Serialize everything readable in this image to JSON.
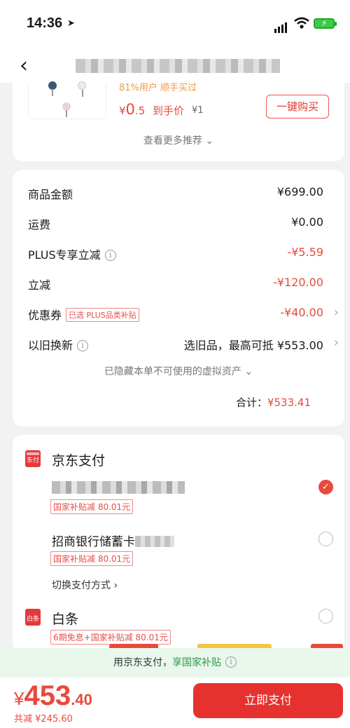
{
  "status": {
    "time": "14:36",
    "battery_symbol": "⚡"
  },
  "nav": {
    "back_glyph": "‹"
  },
  "recommend": {
    "sale_line": "81%用户 顺手买过",
    "currency": "¥",
    "price_int": "0",
    "price_dec": ".5",
    "price_suffix": "到手价",
    "orig_price": "¥1",
    "buy_button": "一键购买",
    "more_text": "查看更多推荐 ⌄"
  },
  "summary": {
    "rows": [
      {
        "label": "商品金额",
        "value": "¥699.00"
      },
      {
        "label": "运费",
        "value": "¥0.00"
      },
      {
        "label": "PLUS专享立减",
        "value": "-¥5.59"
      },
      {
        "label": "立减",
        "value": "-¥120.00"
      },
      {
        "label": "优惠券",
        "tag": "已选 PLUS品类补贴",
        "value": "-¥40.00"
      },
      {
        "label": "以旧换新",
        "value": "选旧品，最高可抵 ¥553.00"
      }
    ],
    "hidden_assets": "已隐藏本单不可使用的虚拟资产 ⌄",
    "total_label": "合计：",
    "total_value": "¥533.41",
    "info_glyph": "i",
    "chevron": "›"
  },
  "payment": {
    "jd_icon_text": "东付",
    "jd_title": "京东支付",
    "card1_subsidy": "国家补贴减 80.01元",
    "bank_name": "招商银行储蓄卡",
    "bank_subsidy": "国家补贴减 80.01元",
    "switch_text": "切换支付方式 ›",
    "baitiao_icon_text": "白条",
    "baitiao_title": "白条",
    "baitiao_tag": "6期免息+国家补贴减 80.01元",
    "check_glyph": "✓"
  },
  "banner": {
    "prefix": "用京东支付，",
    "highlight": "享国家补贴",
    "info": "i"
  },
  "footer": {
    "currency": "¥",
    "amount_int": "453",
    "amount_dec": ".40",
    "saved": "共减 ¥245.60",
    "pay_button": "立即支付"
  },
  "colors": {
    "accent": "#e84a3c",
    "button": "#e6322f",
    "banner_bg": "#e9f7ec",
    "banner_text": "#2c9a4b"
  }
}
